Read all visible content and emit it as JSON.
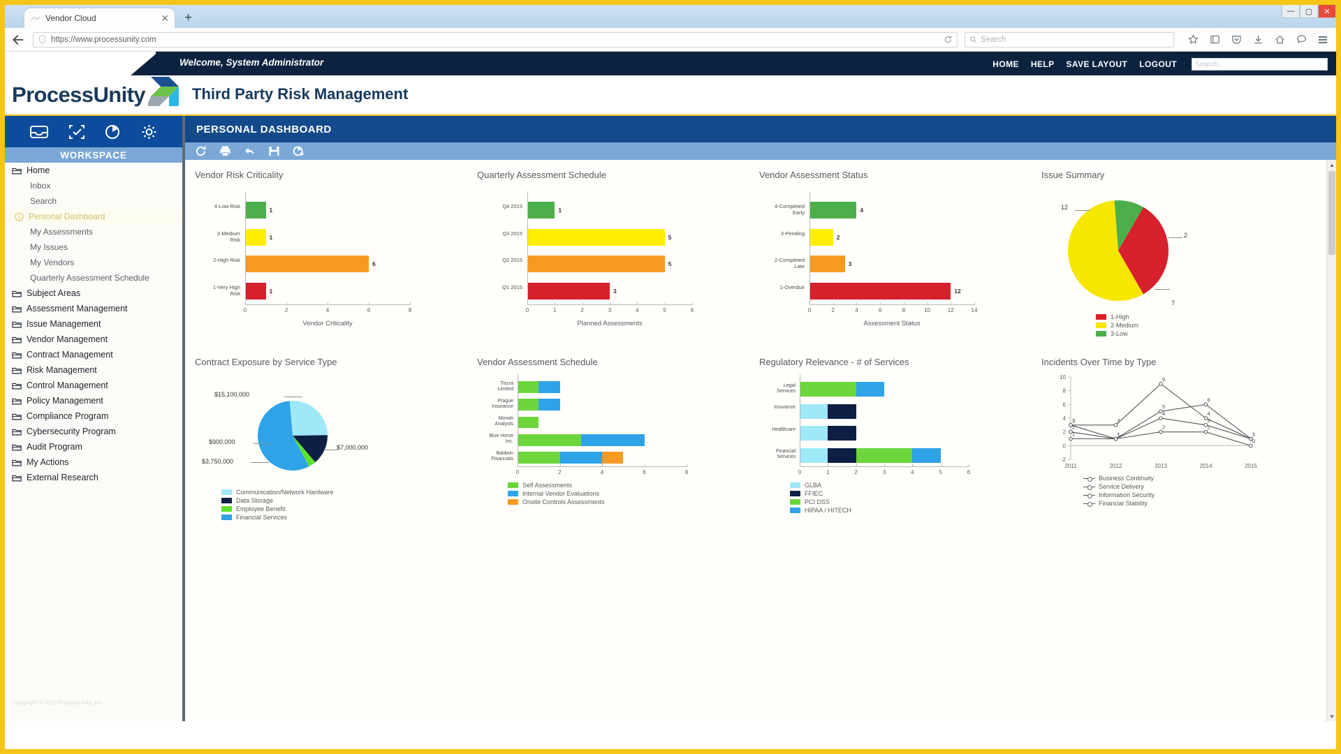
{
  "browser": {
    "tab_title": "Vendor Cloud",
    "tab_close": "✕",
    "new_tab": "+",
    "url": "https://www.processunity.com",
    "search_placeholder": "Search",
    "win_minimize": "—",
    "win_maximize": "▢",
    "win_close": "✕"
  },
  "header": {
    "welcome": "Welcome,  System Administrator",
    "logo": "ProcessUnity",
    "page_title": "Third Party Risk Management",
    "nav": [
      "HOME",
      "HELP",
      "SAVE LAYOUT",
      "LOGOUT"
    ],
    "search_placeholder": "Search...",
    "accent_yellow": "#f5c518",
    "dark_navy": "#0c2340"
  },
  "sidebar": {
    "workspace_label": "WORKSPACE",
    "icons": [
      "inbox-icon",
      "assessment-icon",
      "chart-icon",
      "gear-icon"
    ],
    "items": [
      {
        "label": "Home",
        "type": "folder"
      },
      {
        "label": "Inbox",
        "type": "child"
      },
      {
        "label": "Search",
        "type": "child"
      },
      {
        "label": "Personal Dashboard",
        "type": "child",
        "active": true
      },
      {
        "label": "My Assessments",
        "type": "child"
      },
      {
        "label": "My Issues",
        "type": "child"
      },
      {
        "label": "My Vendors",
        "type": "child"
      },
      {
        "label": "Quarterly Assessment Schedule",
        "type": "child"
      },
      {
        "label": "Subject Areas",
        "type": "folder"
      },
      {
        "label": "Assessment Management",
        "type": "folder"
      },
      {
        "label": "Issue Management",
        "type": "folder"
      },
      {
        "label": "Vendor Management",
        "type": "folder"
      },
      {
        "label": "Contract Management",
        "type": "folder"
      },
      {
        "label": "Risk Management",
        "type": "folder"
      },
      {
        "label": "Control Management",
        "type": "folder"
      },
      {
        "label": "Policy Management",
        "type": "folder"
      },
      {
        "label": "Compliance Program",
        "type": "folder"
      },
      {
        "label": "Cybersecurity Program",
        "type": "folder"
      },
      {
        "label": "Audit Program",
        "type": "folder"
      },
      {
        "label": "My Actions",
        "type": "folder"
      },
      {
        "label": "External Research",
        "type": "folder"
      }
    ],
    "copyright": "Copyright © 2015 ProcessUnity, Inc."
  },
  "dashboard": {
    "title": "PERSONAL DASHBOARD",
    "toolbar": [
      "refresh-icon",
      "print-icon",
      "undo-icon",
      "save-icon",
      "add-chart-icon"
    ]
  },
  "chart_data": [
    {
      "type": "bar",
      "orientation": "horizontal",
      "title": "Vendor Risk Criticality",
      "xlabel": "Vendor Criticality",
      "ylabel": "",
      "categories": [
        "4-Low Risk",
        "3-Medium\nRisk",
        "2-High Risk",
        "1-Very High\nRisk"
      ],
      "values": [
        1,
        1,
        6,
        1
      ],
      "colors": [
        "#4caf4a",
        "#ffee00",
        "#f79a22",
        "#d6212c"
      ],
      "xlim": [
        0,
        8
      ],
      "xticks": [
        0,
        2,
        4,
        6,
        8
      ],
      "grid": false
    },
    {
      "type": "bar",
      "orientation": "horizontal",
      "title": "Quarterly Assessment Schedule",
      "xlabel": "Planned Assessments",
      "ylabel": "",
      "categories": [
        "Q4 2015",
        "Q3 2015",
        "Q2 2015",
        "Q1 2015"
      ],
      "values": [
        1,
        5,
        5,
        3
      ],
      "colors": [
        "#4caf4a",
        "#ffee00",
        "#f79a22",
        "#d6212c"
      ],
      "xlim": [
        0,
        6
      ],
      "xticks": [
        0,
        1,
        2,
        3,
        4,
        5,
        6
      ],
      "grid": false
    },
    {
      "type": "bar",
      "orientation": "horizontal",
      "title": "Vendor Assessment Status",
      "xlabel": "Assessment Status",
      "ylabel": "",
      "categories": [
        "4-Completed\nEarly",
        "3-Pending",
        "2-Completed\nLate",
        "1-Overdue"
      ],
      "values": [
        4,
        2,
        3,
        12
      ],
      "colors": [
        "#4caf4a",
        "#ffee00",
        "#f79a22",
        "#d6212c"
      ],
      "xlim": [
        0,
        14
      ],
      "xticks": [
        0,
        2,
        4,
        6,
        8,
        10,
        12,
        14
      ],
      "grid": false
    },
    {
      "type": "pie",
      "title": "Issue Summary",
      "labels": [
        "1-High",
        "2-Medium",
        "3-Low"
      ],
      "values": [
        7,
        12,
        2
      ],
      "point_labels": [
        "7",
        "12",
        "2"
      ],
      "colors": [
        "#d6212c",
        "#f7e600",
        "#4caf4a"
      ],
      "legend_position": "bottom-left"
    },
    {
      "type": "pie",
      "title": "Contract Exposure by Service Type",
      "labels": [
        "Communication/Network Hardware",
        "Data Storage",
        "Employee Benefit",
        "Financial Services"
      ],
      "values": [
        7000000,
        3750000,
        900000,
        15100000
      ],
      "point_labels": [
        "$7,000,000",
        "$3,750,000",
        "$900,000",
        "$15,100,000"
      ],
      "colors": [
        "#9fe8f7",
        "#0e1f45",
        "#5ce32a",
        "#2ea3e8"
      ],
      "legend_position": "bottom"
    },
    {
      "type": "bar",
      "orientation": "horizontal",
      "stacked": true,
      "title": "Vendor Assessment Schedule",
      "xlabel": "",
      "categories": [
        "Tiscra\nLimited",
        "Prague\nInsurance",
        "Monah\nAnalysts",
        "Blue Horse\nInc.",
        "Baldwin\nFinancials"
      ],
      "series": [
        {
          "name": "Self Assessments",
          "color": "#6cd63c",
          "values": [
            1,
            1,
            1,
            3,
            2
          ]
        },
        {
          "name": "Internal Vendor Evaluations",
          "color": "#2ea3e8",
          "values": [
            1,
            1,
            0,
            3,
            2
          ]
        },
        {
          "name": "Onsite Controls Assessments",
          "color": "#f79a22",
          "values": [
            0,
            0,
            0,
            0,
            1
          ]
        }
      ],
      "xlim": [
        0,
        8
      ],
      "xticks": [
        0,
        2,
        4,
        6,
        8
      ],
      "grid": false
    },
    {
      "type": "bar",
      "orientation": "horizontal",
      "stacked": true,
      "title": "Regulatory Relevance - # of Services",
      "xlabel": "",
      "categories": [
        "Legal\nServices",
        "Insurance",
        "Healthcare",
        "Financial\nServices"
      ],
      "series": [
        {
          "name": "GLBA",
          "color": "#9fe8f7",
          "values": [
            0,
            1,
            1,
            1
          ]
        },
        {
          "name": "FFIEC",
          "color": "#0e1f45",
          "values": [
            0,
            1,
            1,
            1
          ]
        },
        {
          "name": "PCI DSS",
          "color": "#6cd63c",
          "values": [
            2,
            0,
            0,
            2
          ]
        },
        {
          "name": "HIPAA / HITECH",
          "color": "#2ea3e8",
          "values": [
            1,
            0,
            0,
            1
          ]
        }
      ],
      "xlim": [
        0,
        6
      ],
      "xticks": [
        0,
        1,
        2,
        3,
        4,
        5,
        6
      ],
      "grid": false
    },
    {
      "type": "line",
      "title": "Incidents Over Time by Type",
      "x": [
        "2011",
        "2012",
        "2013",
        "2014",
        "2015"
      ],
      "ylim": [
        -2,
        10
      ],
      "yticks": [
        -2,
        0,
        2,
        4,
        6,
        8,
        10
      ],
      "series": [
        {
          "name": "Business Continuity",
          "color": "#555555",
          "values": [
            3,
            3,
            9,
            4,
            1
          ]
        },
        {
          "name": "Service Delivery",
          "color": "#555555",
          "values": [
            3,
            1,
            5,
            6,
            1
          ]
        },
        {
          "name": "Information Security",
          "color": "#555555",
          "values": [
            2,
            1,
            4,
            3,
            1
          ]
        },
        {
          "name": "Financial Stability",
          "color": "#555555",
          "values": [
            1,
            1,
            2,
            2,
            0
          ]
        }
      ],
      "annotations": [
        "3",
        "3",
        "9",
        "4",
        "1",
        "1",
        "5",
        "6",
        "1",
        "2",
        "1",
        "4",
        "3",
        "1"
      ],
      "grid": false
    }
  ]
}
